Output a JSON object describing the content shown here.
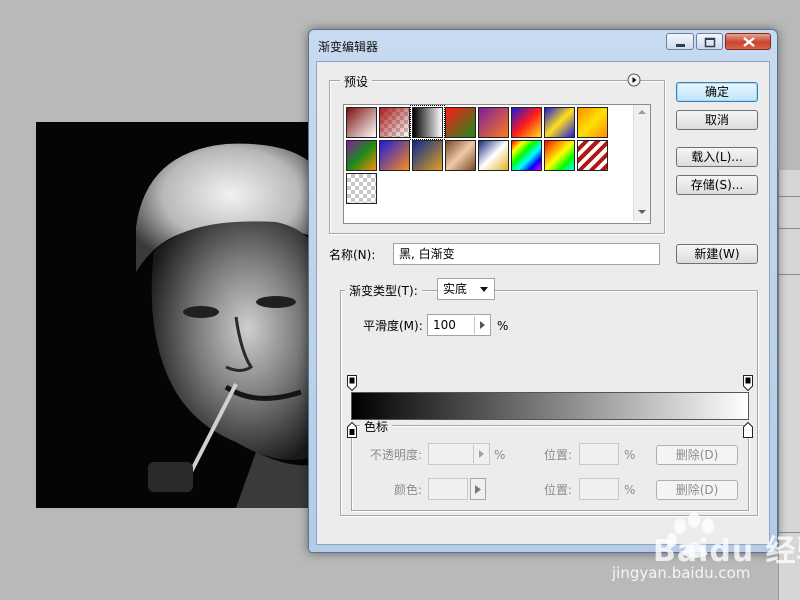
{
  "dialog": {
    "title": "渐变编辑器",
    "buttons": {
      "ok": "确定",
      "cancel": "取消",
      "load": "载入(L)...",
      "save": "存储(S)...",
      "new": "新建(W)"
    },
    "presets": {
      "label": "预设",
      "swatches": [
        "linear-gradient(135deg,#7a1010,#ffffff)",
        "checker-red",
        "linear-gradient(90deg,#000,#fff)",
        "linear-gradient(135deg,#ff1a1a,#1a8c1a)",
        "linear-gradient(135deg,#7a1fa0,#ff7a1a)",
        "linear-gradient(135deg,#1a1ae0,#ff1a1a,#ffe01a)",
        "linear-gradient(135deg,#1a1ae0,#ffe01a,#1a1ae0)",
        "linear-gradient(135deg,#ff8c00,#ffe000,#ff8c00)",
        "linear-gradient(135deg,#8a1aa0,#1a8c1a,#ff8c00)",
        "linear-gradient(135deg,#1a1ae0,#ff8c1a)",
        "linear-gradient(135deg,#0a2a90,#e0a020)",
        "linear-gradient(135deg,#7a4a2a,#f0c8a8,#7a4a2a)",
        "linear-gradient(135deg,#1a2a80,#ffffff,#e0b020)",
        "linear-gradient(135deg,#ff0000,#ffff00,#00ff00,#00ffff,#0000ff,#ff00ff)",
        "linear-gradient(135deg,#ff0000,#ff8800,#ffff00,#00ff00,#00ffff)",
        "repeating-linear-gradient(135deg,#ffffff 0 4px,#b01818 4px 8px)",
        "checker"
      ]
    },
    "name": {
      "label": "名称(N):",
      "value": "黑, 白渐变"
    },
    "gradient_type": {
      "label": "渐变类型(T):",
      "value": "实底"
    },
    "smoothness": {
      "label": "平滑度(M):",
      "value": "100",
      "unit": "%"
    },
    "color_stops": {
      "label": "色标",
      "opacity_label": "不透明度:",
      "opacity_unit": "%",
      "color_label": "颜色:",
      "location_label": "位置:",
      "location_unit": "%",
      "delete_label": "删除(D)"
    }
  },
  "watermark": {
    "text": "Baidu 经验",
    "sub": "jingyan.baidu.com"
  }
}
